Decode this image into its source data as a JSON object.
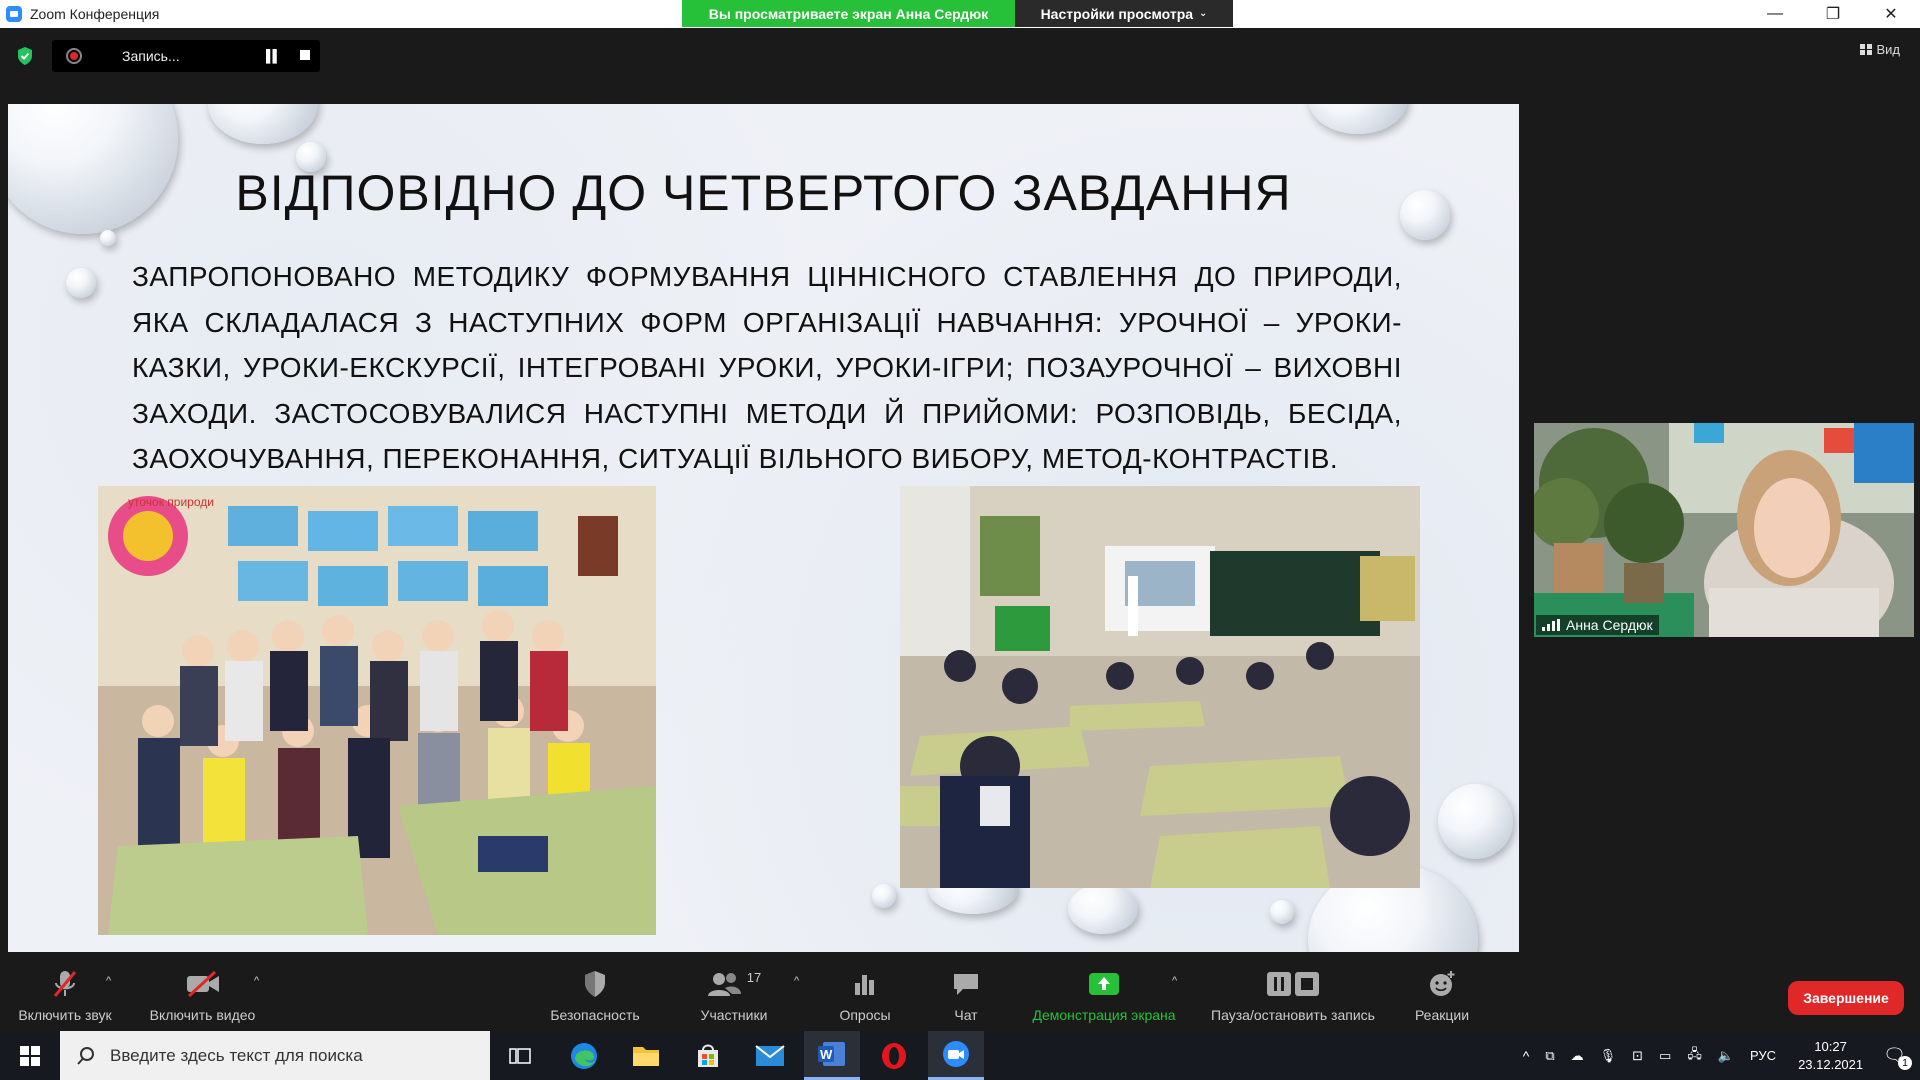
{
  "window": {
    "title": "Zoom Конференция",
    "viewing_banner": "Вы просматриваете экран Анна Сердюк",
    "view_settings": "Настройки просмотра"
  },
  "topbar": {
    "recording_label": "Запись...",
    "view_label": "Вид"
  },
  "slide": {
    "title": "ВІДПОВІДНО ДО ЧЕТВЕРТОГО ЗАВДАННЯ",
    "body": "ЗАПРОПОНОВАНО МЕТОДИКУ ФОРМУВАННЯ ЦІННІСНОГО СТАВЛЕННЯ ДО ПРИРОДИ, ЯКА СКЛАДАЛАСЯ З НАСТУПНИХ ФОРМ ОРГАНІЗАЦІЇ НАВЧАННЯ: УРОЧНОЇ – УРОКИ-КАЗКИ, УРОКИ-ЕКСКУРСІЇ, ІНТЕГРОВАНІ УРОКИ, УРОКИ-ІГРИ; ПОЗАУРОЧНОЇ – ВИХОВНІ ЗАХОДИ. ЗАСТОСОВУВАЛИСЯ НАСТУПНІ МЕТОДИ Й ПРИЙОМИ: РОЗПОВІДЬ, БЕСІДА, ЗАОХОЧУВАННЯ, ПЕРЕКОНАННЯ, СИТУАЦІЇ ВІЛЬНОГО ВИБОРУ, МЕТОД-КОНТРАСТІВ.",
    "poster_text": "уточок природи"
  },
  "participant": {
    "name": "Анна Сердюк"
  },
  "toolbar": {
    "unmute": "Включить звук",
    "start_video": "Включить видео",
    "security": "Безопасность",
    "participants": "Участники",
    "participants_count": "17",
    "polls": "Опросы",
    "chat": "Чат",
    "share_screen": "Демонстрация экрана",
    "pause_record": "Пауза/остановить запись",
    "reactions": "Реакции",
    "end": "Завершение"
  },
  "taskbar": {
    "search_placeholder": "Введите здесь текст для поиска",
    "language": "РУС",
    "time": "10:27",
    "date": "23.12.2021",
    "notifications": "1"
  },
  "colors": {
    "zoom_blue": "#2d8cff",
    "banner_green": "#26c138",
    "end_red": "#e02828",
    "share_green": "#26c138"
  }
}
